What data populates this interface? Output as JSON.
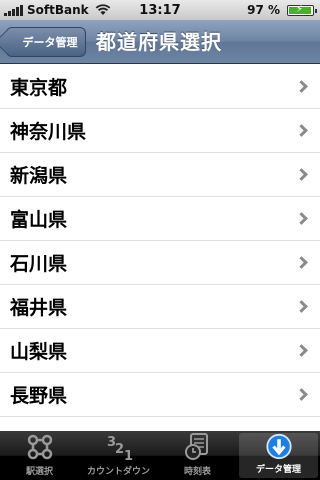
{
  "status_bar": {
    "carrier": "SoftBank",
    "time": "13:17",
    "battery_percent": "97 %",
    "battery_level": 0.97
  },
  "nav_bar": {
    "back_label": "データ管理",
    "title": "都道府県選択"
  },
  "list": {
    "items": [
      "東京都",
      "神奈川県",
      "新潟県",
      "富山県",
      "石川県",
      "福井県",
      "山梨県",
      "長野県"
    ]
  },
  "tab_bar": {
    "tabs": [
      {
        "label": "駅選択",
        "icon": "station-icon",
        "selected": false
      },
      {
        "label": "カウントダウン",
        "icon": "countdown-icon",
        "selected": false
      },
      {
        "label": "時刻表",
        "icon": "timetable-icon",
        "selected": false
      },
      {
        "label": "データ管理",
        "icon": "data-manage-icon",
        "selected": true
      }
    ]
  },
  "colors": {
    "nav_bar": "#6d84a2",
    "selected_tab_icon": "#1f7fe0"
  }
}
